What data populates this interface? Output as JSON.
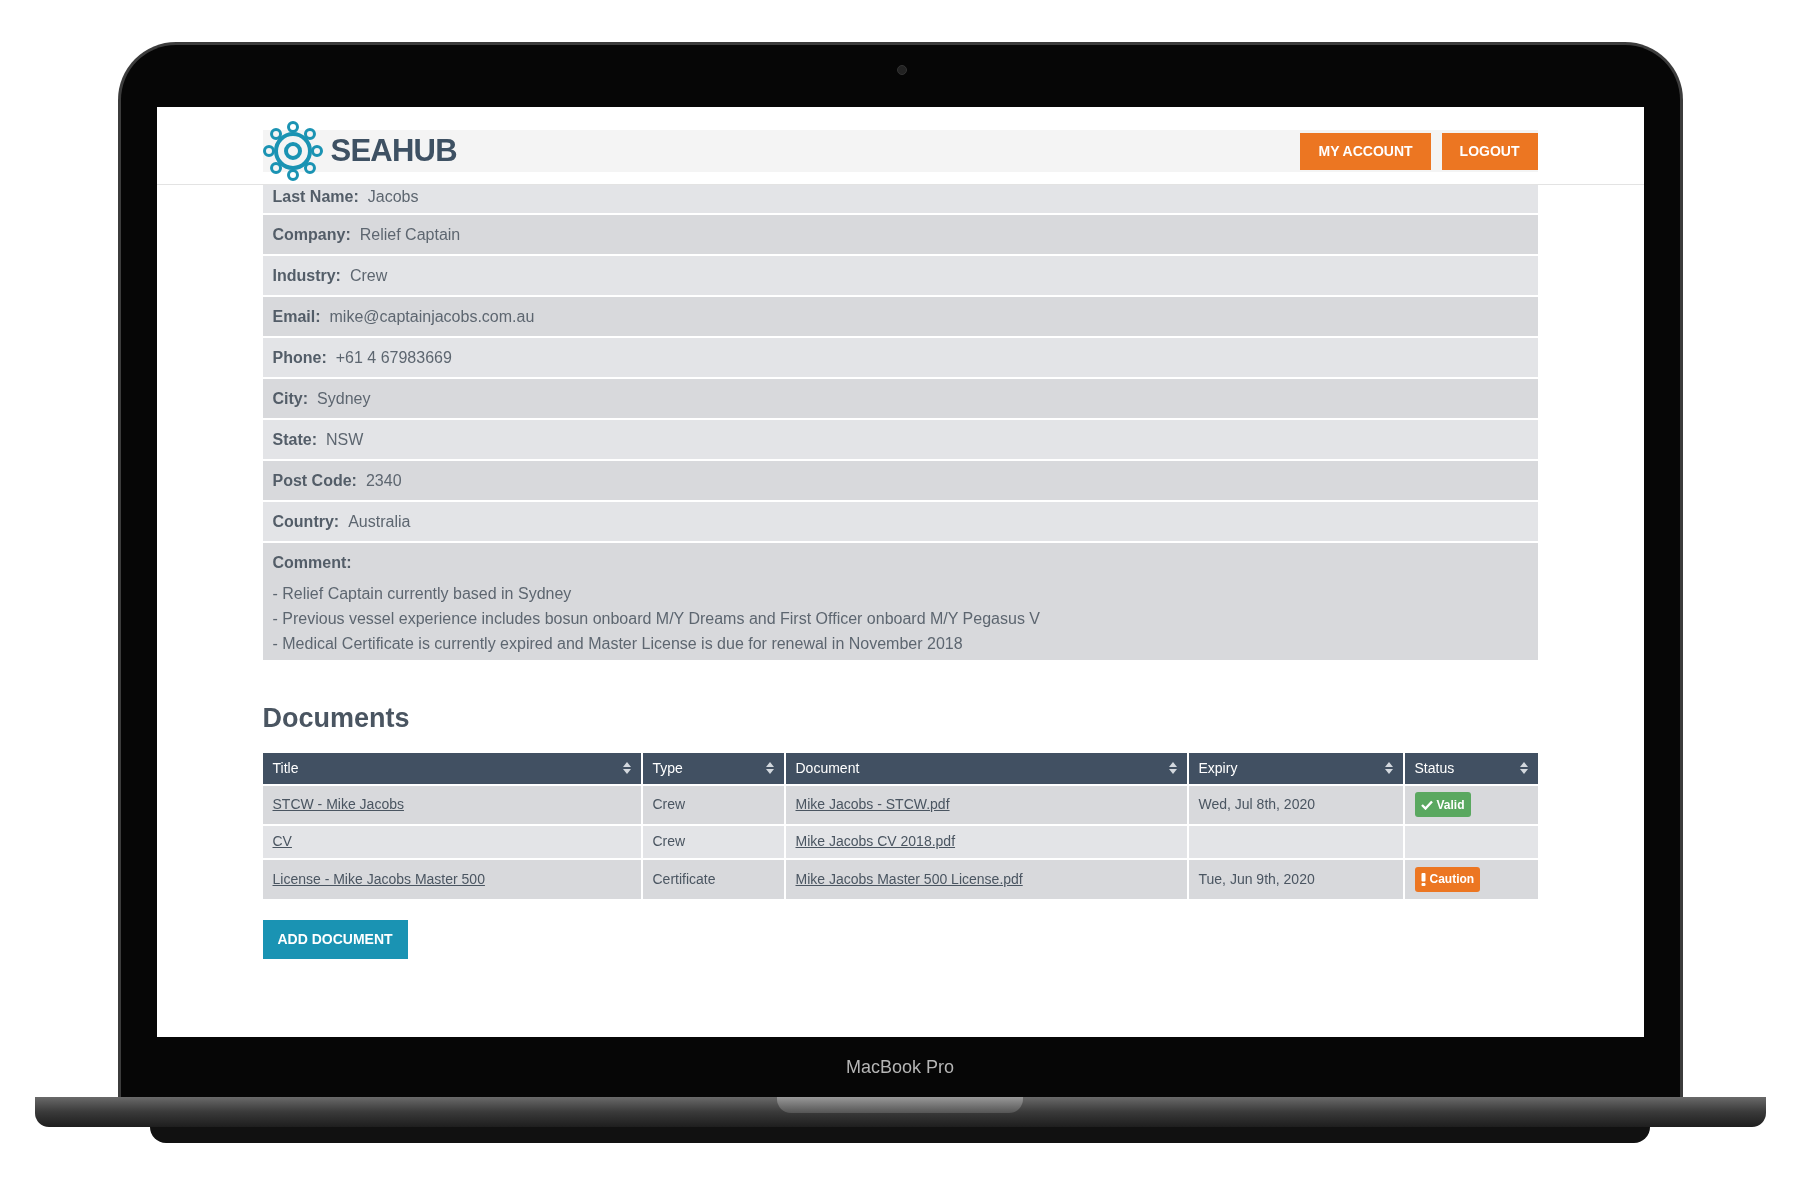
{
  "brand": {
    "name": "SEAHUB"
  },
  "nav": {
    "buttons": [
      "MY ACCOUNT",
      "LOGOUT"
    ]
  },
  "profile": {
    "fields": [
      {
        "label": "Last Name:",
        "value": "Jacobs"
      },
      {
        "label": "Company:",
        "value": "Relief Captain"
      },
      {
        "label": "Industry:",
        "value": "Crew"
      },
      {
        "label": "Email:",
        "value": "mike@captainjacobs.com.au"
      },
      {
        "label": "Phone:",
        "value": "+61 4 67983669"
      },
      {
        "label": "City:",
        "value": "Sydney"
      },
      {
        "label": "State:",
        "value": "NSW"
      },
      {
        "label": "Post Code:",
        "value": "2340"
      },
      {
        "label": "Country:",
        "value": "Australia"
      }
    ],
    "comment": {
      "label": "Comment:",
      "lines": [
        "- Relief Captain currently based in Sydney",
        "- Previous vessel experience includes bosun onboard M/Y Dreams and First Officer onboard M/Y Pegasus V",
        "- Medical Certificate is currently expired and Master License is due for renewal in November 2018"
      ]
    }
  },
  "documents": {
    "heading": "Documents",
    "columns": [
      "Title",
      "Type",
      "Document",
      "Expiry",
      "Status"
    ],
    "rows": [
      {
        "title": "STCW - Mike Jacobs",
        "type": "Crew",
        "document": "Mike Jacobs - STCW.pdf",
        "expiry": "Wed, Jul 8th, 2020",
        "status": {
          "kind": "valid",
          "label": "Valid"
        }
      },
      {
        "title": "CV",
        "type": "Crew",
        "document": "Mike Jacobs CV 2018.pdf"
      },
      {
        "title": "License - Mike Jacobs Master 500",
        "type": "Certificate",
        "document": "Mike Jacobs Master 500 License.pdf",
        "expiry": "Tue, Jun 9th, 2020",
        "status": {
          "kind": "caution",
          "label": "Caution"
        }
      }
    ],
    "add_button": "ADD DOCUMENT"
  },
  "device": {
    "label": "MacBook Pro"
  }
}
